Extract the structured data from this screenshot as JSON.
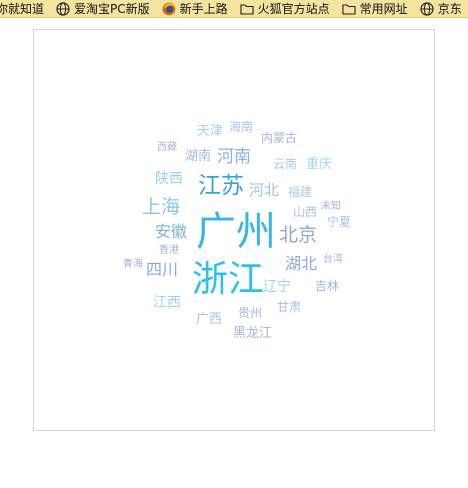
{
  "bookmarks": [
    {
      "label": "你就知道",
      "icon": "none"
    },
    {
      "label": "爱淘宝PC新版",
      "icon": "globe-icon"
    },
    {
      "label": "新手上路",
      "icon": "firefox-icon"
    },
    {
      "label": "火狐官方站点",
      "icon": "folder-icon"
    },
    {
      "label": "常用网址",
      "icon": "folder-icon"
    },
    {
      "label": "京东",
      "icon": "globe-icon"
    }
  ],
  "wordcloud": {
    "words": [
      {
        "text": "广州",
        "color": "#37b4e8"
      },
      {
        "text": "浙江",
        "color": "#2dc0ee"
      },
      {
        "text": "江苏",
        "color": "#3aa1d8"
      },
      {
        "text": "上海",
        "color": "#8cc4e8"
      },
      {
        "text": "河南",
        "color": "#8bb0d8"
      },
      {
        "text": "北京",
        "color": "#8ea7d6"
      },
      {
        "text": "湖北",
        "color": "#8eaad8"
      },
      {
        "text": "四川",
        "color": "#8aa8dc"
      },
      {
        "text": "安徽",
        "color": "#7fb2da"
      },
      {
        "text": "河北",
        "color": "#a0c2e2"
      },
      {
        "text": "陕西",
        "color": "#96d0ee"
      },
      {
        "text": "湖南",
        "color": "#9fb8e0"
      },
      {
        "text": "天津",
        "color": "#9fd6f0"
      },
      {
        "text": "海南",
        "color": "#a8c4ea"
      },
      {
        "text": "内蒙古",
        "color": "#a7b6e0"
      },
      {
        "text": "云南",
        "color": "#a9c8ea"
      },
      {
        "text": "重庆",
        "color": "#9fd8f2"
      },
      {
        "text": "福建",
        "color": "#a9cdea"
      },
      {
        "text": "山西",
        "color": "#a5bfe6"
      },
      {
        "text": "未知",
        "color": "#a3b4da"
      },
      {
        "text": "宁夏",
        "color": "#9fc8ec"
      },
      {
        "text": "西藏",
        "color": "#aab4dc"
      },
      {
        "text": "香港",
        "color": "#a4b4d8"
      },
      {
        "text": "青海",
        "color": "#9fb0d6"
      },
      {
        "text": "台湾",
        "color": "#a7b8dc"
      },
      {
        "text": "辽宁",
        "color": "#9ed2f0"
      },
      {
        "text": "吉林",
        "color": "#9fb6e0"
      },
      {
        "text": "江西",
        "color": "#a2d2f0"
      },
      {
        "text": "广西",
        "color": "#a7c4e8"
      },
      {
        "text": "贵州",
        "color": "#a6b8dc"
      },
      {
        "text": "甘肃",
        "color": "#a8bce2"
      },
      {
        "text": "黑龙江",
        "color": "#a7b6de"
      }
    ]
  }
}
